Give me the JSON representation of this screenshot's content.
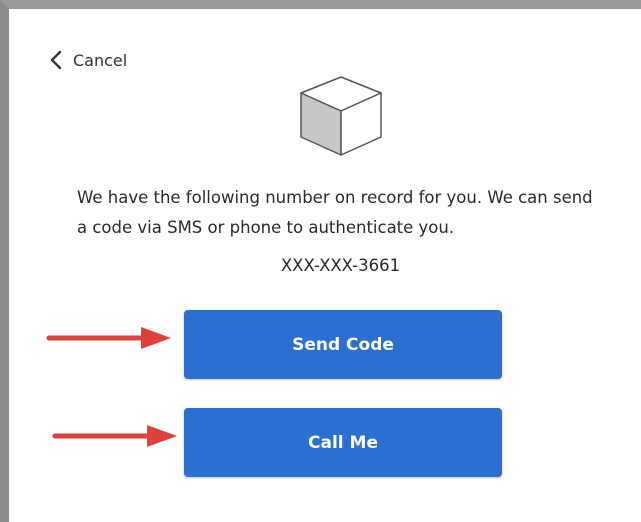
{
  "nav": {
    "cancel_label": "Cancel"
  },
  "logo": {
    "icon": "cube-icon"
  },
  "content": {
    "message": "We have the following number on record for you. We can send a code via SMS or phone to authenticate you.",
    "phone_number": "XXX-XXX-3661"
  },
  "actions": {
    "send_code_label": "Send Code",
    "call_me_label": "Call Me"
  },
  "colors": {
    "button": "#2b6fd1",
    "annotation_arrow": "#e0403a"
  }
}
